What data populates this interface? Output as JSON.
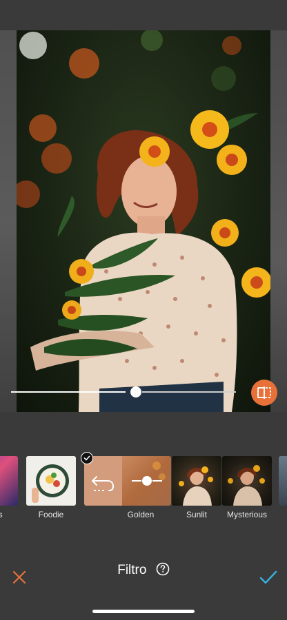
{
  "slider": {
    "value": 0.55
  },
  "filters": [
    {
      "label": "nds"
    },
    {
      "label": "Foodie"
    },
    {
      "label": "Golden"
    },
    {
      "label": "Sunlit"
    },
    {
      "label": "Mysterious"
    }
  ],
  "bottom_bar": {
    "title": "Filtro",
    "cancel_icon": "close-icon",
    "help_icon": "help-circle-icon",
    "confirm_icon": "checkmark-icon"
  },
  "colors": {
    "accent_orange": "#e8713a",
    "confirm_blue": "#3ab0e2",
    "background": "#3a3a3a"
  }
}
